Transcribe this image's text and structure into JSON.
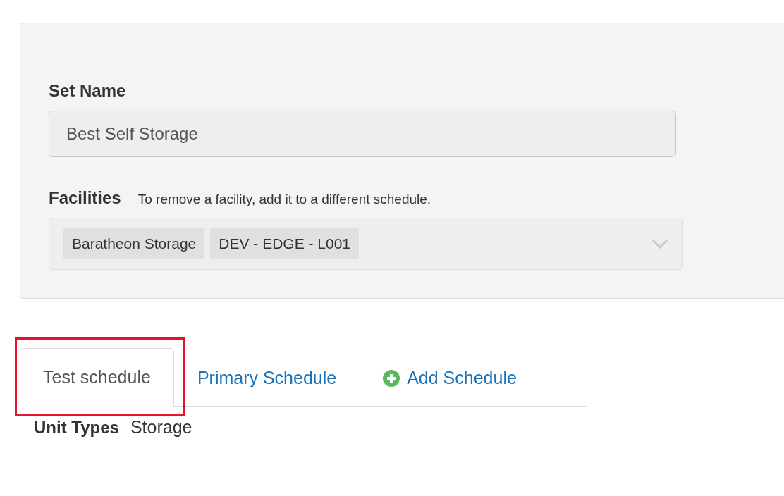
{
  "set_name": {
    "label": "Set Name",
    "value": "Best Self Storage"
  },
  "facilities": {
    "label": "Facilities",
    "hint": "To remove a facility, add it to a different schedule.",
    "tags": [
      "Baratheon Storage",
      "DEV - EDGE - L001"
    ]
  },
  "tabs": [
    {
      "kind": "tab",
      "label": "Test schedule",
      "selected": true,
      "highlighted": true
    },
    {
      "kind": "tab",
      "label": "Primary Schedule",
      "selected": false,
      "highlighted": false
    },
    {
      "kind": "add",
      "label": "Add Schedule",
      "selected": false,
      "highlighted": false
    }
  ],
  "unit_types": {
    "label": "Unit Types",
    "value": "Storage"
  }
}
